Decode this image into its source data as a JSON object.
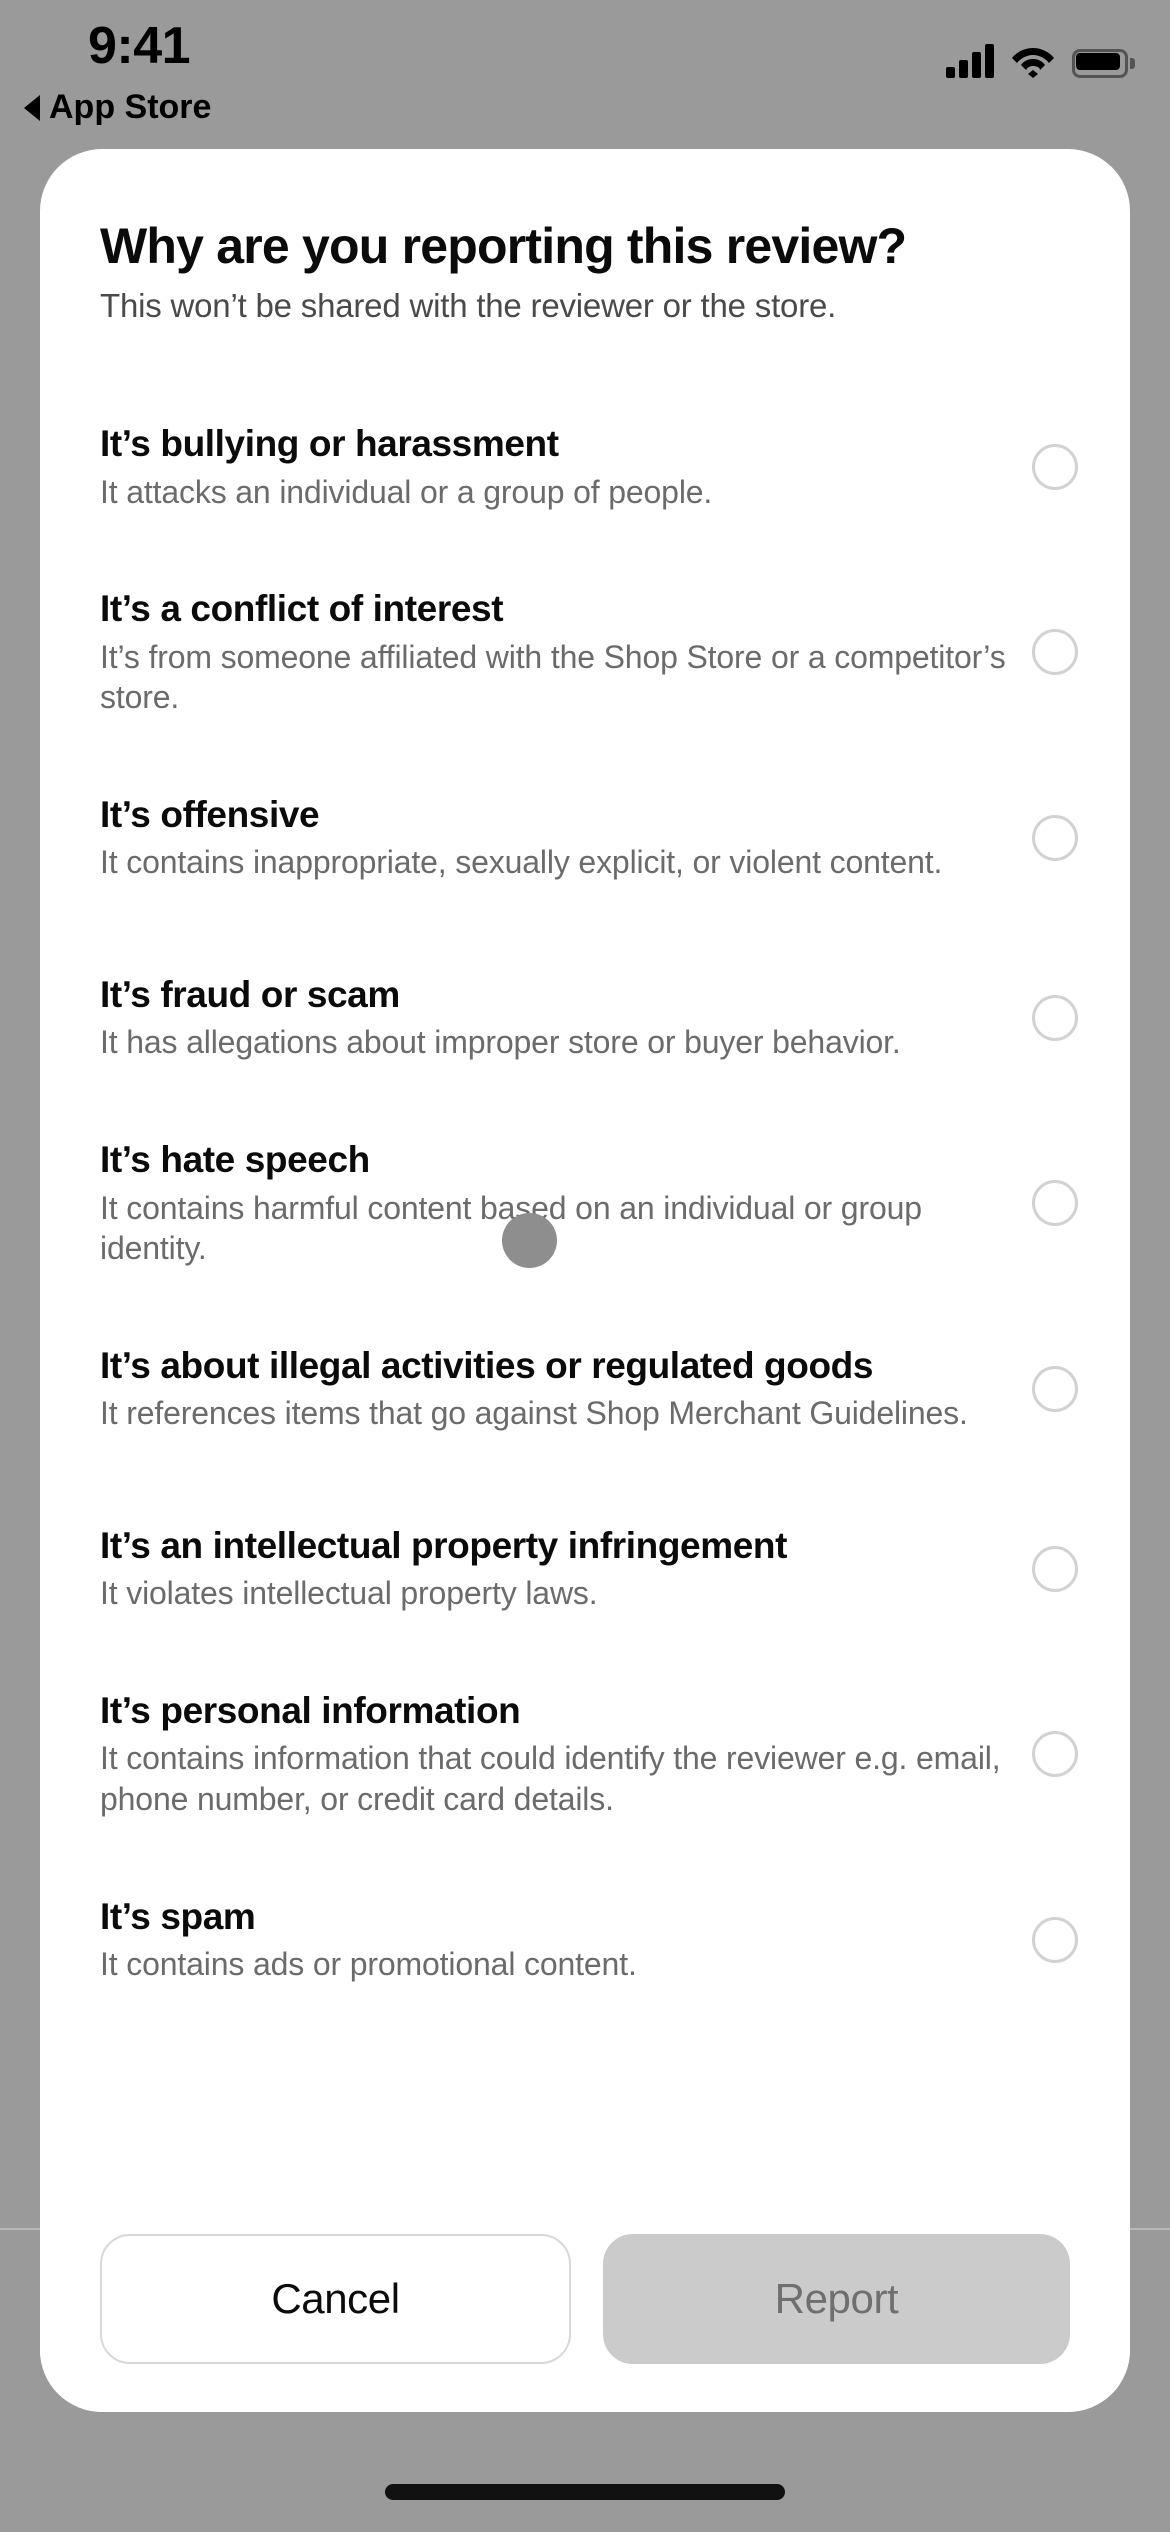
{
  "status_bar": {
    "time": "9:41",
    "back_label": "App Store",
    "signal_icon": "cellular-signal-icon",
    "wifi_icon": "wifi-icon",
    "battery_icon": "battery-full-icon"
  },
  "dialog": {
    "title": "Why are you reporting this review?",
    "subtitle": "This won’t be shared with the reviewer or the store."
  },
  "options": [
    {
      "title": "It’s bullying or harassment",
      "desc": "It attacks an individual or a group of people.",
      "selected": false
    },
    {
      "title": "It’s a conflict of interest",
      "desc": "It’s from someone affiliated with the Shop Store or a competitor’s store.",
      "selected": false
    },
    {
      "title": "It’s offensive",
      "desc": "It contains inappropriate, sexually explicit, or violent content.",
      "selected": false
    },
    {
      "title": "It’s fraud or scam",
      "desc": "It has allegations about improper store or buyer behavior.",
      "selected": false
    },
    {
      "title": "It’s hate speech",
      "desc": "It contains harmful content based on an individual or group identity.",
      "selected": false
    },
    {
      "title": "It’s about illegal activities or regulated goods",
      "desc": "It references items that go against Shop Merchant Guidelines.",
      "selected": false
    },
    {
      "title": "It’s an intellectual property infringement",
      "desc": "It violates intellectual property laws.",
      "selected": false
    },
    {
      "title": "It’s personal information",
      "desc": "It contains information that could identify the reviewer e.g. email, phone number, or credit card details.",
      "selected": false
    },
    {
      "title": "It’s spam",
      "desc": "It contains ads or promotional content.",
      "selected": false
    }
  ],
  "footer": {
    "cancel_label": "Cancel",
    "report_label": "Report",
    "report_enabled": false
  },
  "colors": {
    "backdrop": "#9a9a9a",
    "sheet": "#ffffff",
    "title_text": "#0b0b0b",
    "desc_text": "#6b6b6b",
    "radio_border": "#d2d2d2",
    "report_bg": "#cbcbcb",
    "report_text": "#6f6f6f",
    "touch_indicator": "#8e8e8e",
    "home_indicator": "#111111"
  }
}
